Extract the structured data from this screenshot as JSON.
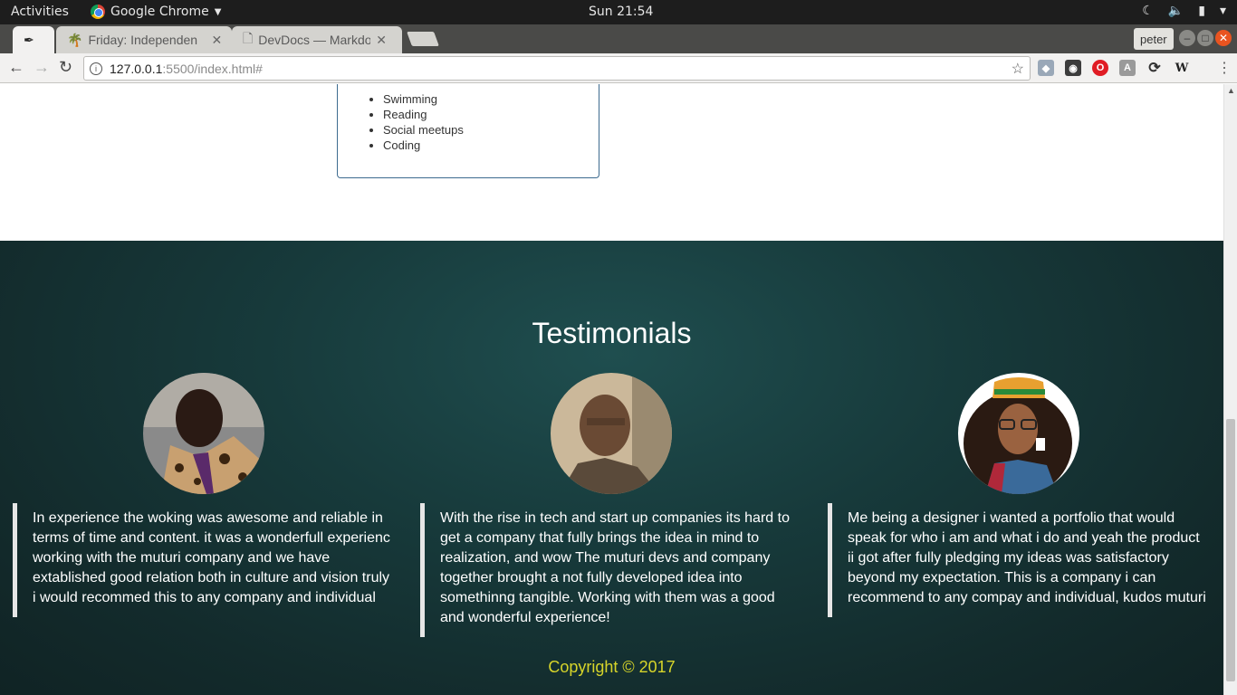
{
  "system": {
    "activities": "Activities",
    "app_name": "Google Chrome",
    "clock": "Sun 21:54"
  },
  "browser": {
    "tabs": [
      {
        "title": "",
        "active": true
      },
      {
        "title": "Friday: Independen",
        "active": false
      },
      {
        "title": "DevDocs — Markdo",
        "active": false
      }
    ],
    "profile": "peter",
    "url_host": "127.0.0.1",
    "url_path": ":5500/index.html#",
    "extensions": [
      "dropbox-icon",
      "evernote-icon",
      "opera-icon",
      "angular-icon",
      "sync-icon",
      "wikipedia-icon"
    ],
    "wiki_label": "W"
  },
  "hobbies": {
    "items": [
      "Swimming",
      "Reading",
      "Social meetups",
      "Coding"
    ]
  },
  "testimonials": {
    "heading": "Testimonials",
    "items": [
      {
        "text": "In experience the woking was awesome and reliable in terms of time and content. it was a wonderfull experienc working with the muturi company and we have extablished good relation both in culture and vision truly i would recommed this to any company and individual"
      },
      {
        "text": "With the rise in tech and start up companies its hard to get a company that fully brings the idea in mind to realization, and wow The muturi devs and company together brought a not fully developed idea into somethinng tangible. Working with them was a good and wonderful experience!"
      },
      {
        "text": "Me being a designer i wanted a portfolio that would speak for who i am and what i do and yeah the product ii got after fully pledging my ideas was satisfactory beyond my expectation. This is a company i can recommend to any compay and individual, kudos muturi"
      }
    ],
    "copyright": "Copyright © 2017"
  },
  "colors": {
    "section_bg": "#173a3b",
    "copyright": "#d7d52a",
    "card_border": "#3d6b8f"
  }
}
